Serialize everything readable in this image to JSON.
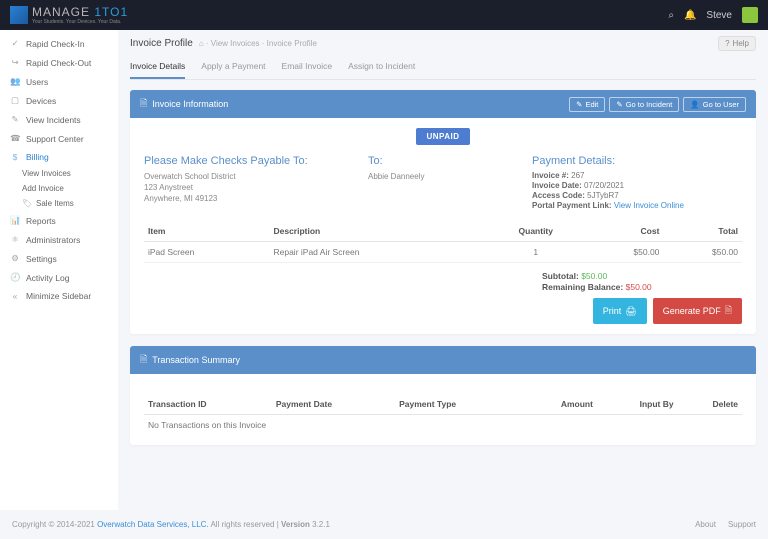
{
  "brand": {
    "name1": "MANAGE",
    "name2": "1TO1",
    "tagline": "Your Students. Your Devices. Your Data."
  },
  "user": {
    "name": "Steve"
  },
  "sidebar": {
    "items": [
      {
        "icon": "✓",
        "label": "Rapid Check-In"
      },
      {
        "icon": "↪",
        "label": "Rapid Check-Out"
      },
      {
        "icon": "👥",
        "label": "Users"
      },
      {
        "icon": "▢",
        "label": "Devices"
      },
      {
        "icon": "✎",
        "label": "View Incidents"
      },
      {
        "icon": "☎",
        "label": "Support Center"
      },
      {
        "icon": "$",
        "label": "Billing",
        "active": true,
        "children": [
          {
            "label": "View Invoices"
          },
          {
            "label": "Add Invoice"
          },
          {
            "icon": "🏷",
            "label": "Sale Items"
          }
        ]
      },
      {
        "icon": "📊",
        "label": "Reports"
      },
      {
        "icon": "⚛",
        "label": "Administrators"
      },
      {
        "icon": "⚙",
        "label": "Settings"
      },
      {
        "icon": "🕘",
        "label": "Activity Log"
      },
      {
        "icon": "«",
        "label": "Minimize Sidebar"
      }
    ]
  },
  "page": {
    "title": "Invoice Profile",
    "crumb1": "View Invoices",
    "crumb2": "Invoice Profile",
    "help": "Help"
  },
  "tabs": [
    {
      "label": "Invoice Details",
      "active": true
    },
    {
      "label": "Apply a Payment"
    },
    {
      "label": "Email Invoice"
    },
    {
      "label": "Assign to Incident"
    }
  ],
  "invoice_card": {
    "title": "Invoice Information",
    "actions": {
      "edit": "Edit",
      "goto_incident": "Go to Incident",
      "goto_user": "Go to User"
    },
    "status": "UNPAID",
    "payable": {
      "heading": "Please Make Checks Payable To:",
      "name": "Overwatch School District",
      "line1": "123 Anystreet",
      "line2": "Anywhere, MI 49123"
    },
    "to": {
      "heading": "To:",
      "name": "Abbie Danneely"
    },
    "payment": {
      "heading": "Payment Details:",
      "invoice_no_lbl": "Invoice #:",
      "invoice_no": "267",
      "date_lbl": "Invoice Date:",
      "date": "07/20/2021",
      "code_lbl": "Access Code:",
      "code": "5JTybR7",
      "link_lbl": "Portal Payment Link:",
      "link": "View Invoice Online"
    },
    "table": {
      "headers": {
        "item": "Item",
        "desc": "Description",
        "qty": "Quantity",
        "cost": "Cost",
        "total": "Total"
      },
      "rows": [
        {
          "item": "iPad Screen",
          "desc": "Repair iPad Air Screen",
          "qty": "1",
          "cost": "$50.00",
          "total": "$50.00"
        }
      ]
    },
    "totals": {
      "subtotal_lbl": "Subtotal:",
      "subtotal": "$50.00",
      "balance_lbl": "Remaining Balance:",
      "balance": "$50.00"
    },
    "buttons": {
      "print": "Print",
      "pdf": "Generate PDF"
    }
  },
  "txn_card": {
    "title": "Transaction Summary",
    "headers": {
      "id": "Transaction ID",
      "date": "Payment Date",
      "type": "Payment Type",
      "amount": "Amount",
      "input_by": "Input By",
      "delete": "Delete"
    },
    "empty": "No Transactions on this Invoice"
  },
  "footer": {
    "copy_pre": "Copyright © 2014-2021 ",
    "company": "Overwatch Data Services, LLC.",
    "copy_post": " All rights reserved | ",
    "version_lbl": "Version ",
    "version": "3.2.1",
    "about": "About",
    "support": "Support"
  }
}
